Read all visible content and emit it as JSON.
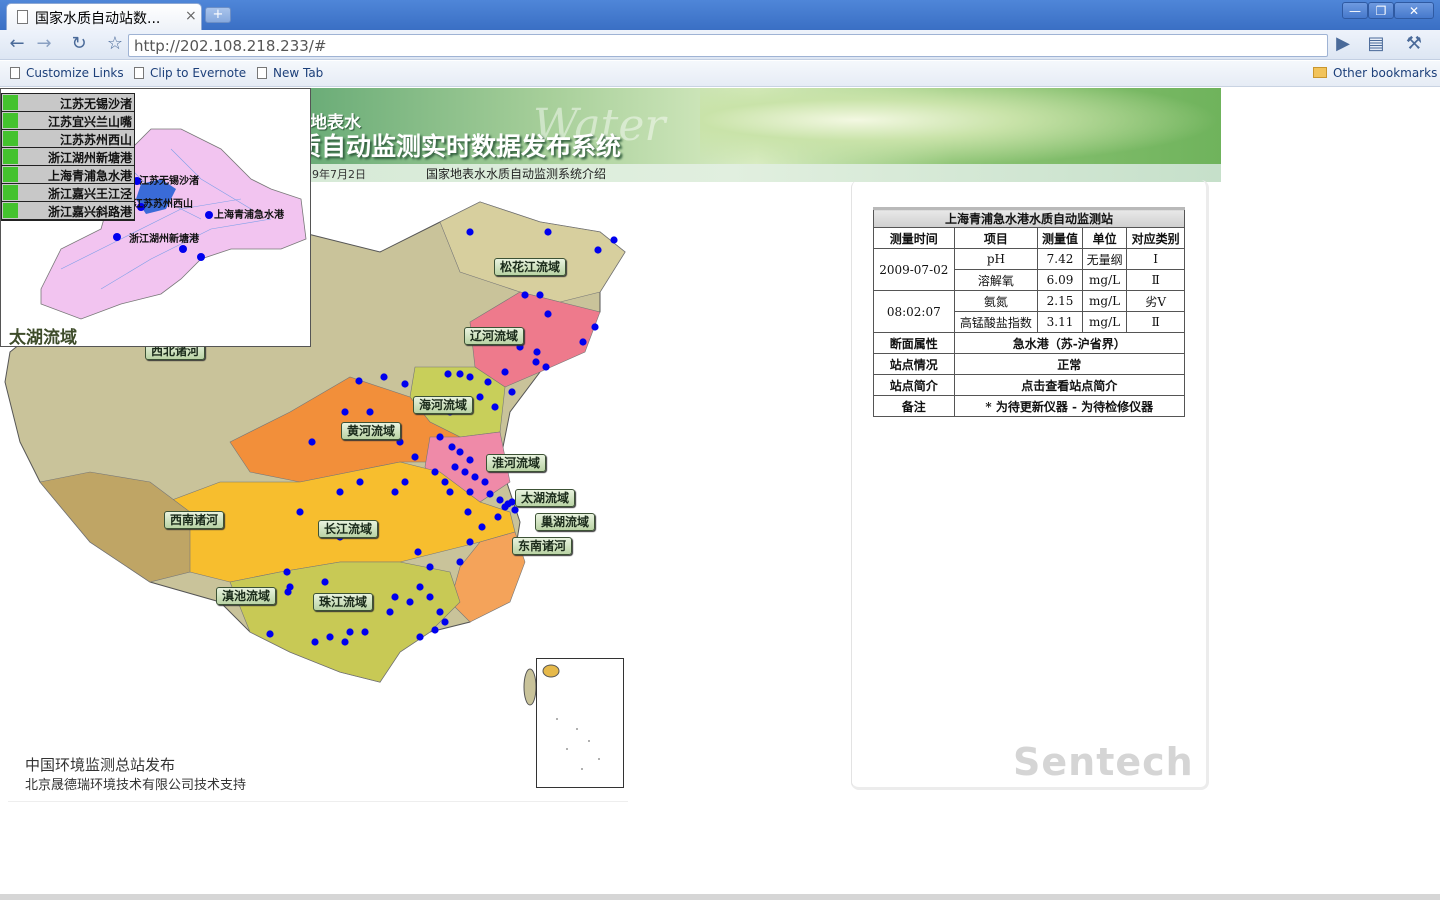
{
  "browser": {
    "tab_title": "国家水质自动站数...",
    "tab_close": "×",
    "new_tab": "+",
    "url": "http://202.108.218.233/#",
    "bookmarks": [
      "Customize Links",
      "Clip to Evernote",
      "New Tab"
    ],
    "other_bookmarks": "Other bookmarks",
    "window_controls": {
      "min": "—",
      "max": "❐",
      "close": "✕"
    }
  },
  "banner": {
    "subtitle": "地表水",
    "title": "质自动监测实时数据发布系统",
    "watermark": "Water",
    "date": "9年7月2日",
    "intro_link": "国家地表水水质自动监测系统介绍"
  },
  "map": {
    "basins": [
      "松花江流域",
      "辽河流域",
      "海河流域",
      "黄河流域",
      "淮河流域",
      "太湖流域",
      "巢湖流域",
      "东南诸河",
      "长江流域",
      "西南诸河",
      "滇池流域",
      "珠江流域",
      "西北诸河"
    ],
    "footer_org": "中国环境监测总站发布",
    "footer_tech": "北京晟德瑞环境技术有限公司技术支持"
  },
  "taihu": {
    "region_title": "太湖流域",
    "stations": [
      "江苏无锡沙渚",
      "江苏宜兴兰山嘴",
      "江苏苏州西山",
      "浙江湖州新塘港",
      "上海青浦急水港",
      "浙江嘉兴王江泾",
      "浙江嘉兴斜路港"
    ],
    "map_labels": [
      "江苏无锡沙渚",
      "江苏苏州西山",
      "上海青浦急水港",
      "浙江湖州新塘港"
    ]
  },
  "station_table": {
    "caption": "上海青浦急水港水质自动监测站",
    "headers": [
      "测量时间",
      "项目",
      "测量值",
      "单位",
      "对应类别"
    ],
    "date": "2009-07-02",
    "time": "08:02:07",
    "rows": [
      {
        "item": "pH",
        "value": "7.42",
        "unit": "无量纲",
        "class": "Ⅰ"
      },
      {
        "item": "溶解氧",
        "value": "6.09",
        "unit": "mg/L",
        "class": "Ⅱ"
      },
      {
        "item": "氨氮",
        "value": "2.15",
        "unit": "mg/L",
        "class": "劣Ⅴ"
      },
      {
        "item": "高锰酸盐指数",
        "value": "3.11",
        "unit": "mg/L",
        "class": "Ⅱ"
      }
    ],
    "section_label": "断面属性",
    "section_value": "急水港（苏-沪省界）",
    "status_label": "站点情况",
    "status_value": "正常",
    "intro_label": "站点简介",
    "intro_value": "点击查看站点简介",
    "remark_label": "备注",
    "remark_value": "* 为待更新仪器 - 为待检修仪器"
  },
  "logo": "Sentech",
  "colors": {
    "station_dot": "#0000ee",
    "station_flag": "#44c22e",
    "yangtze": "#f7be2e",
    "yellow_river": "#f28f3a",
    "liao_river": "#ee7a8c",
    "northwest": "#c9c39a",
    "songhua": "#d7cf9e",
    "pearl": "#c8c955"
  }
}
